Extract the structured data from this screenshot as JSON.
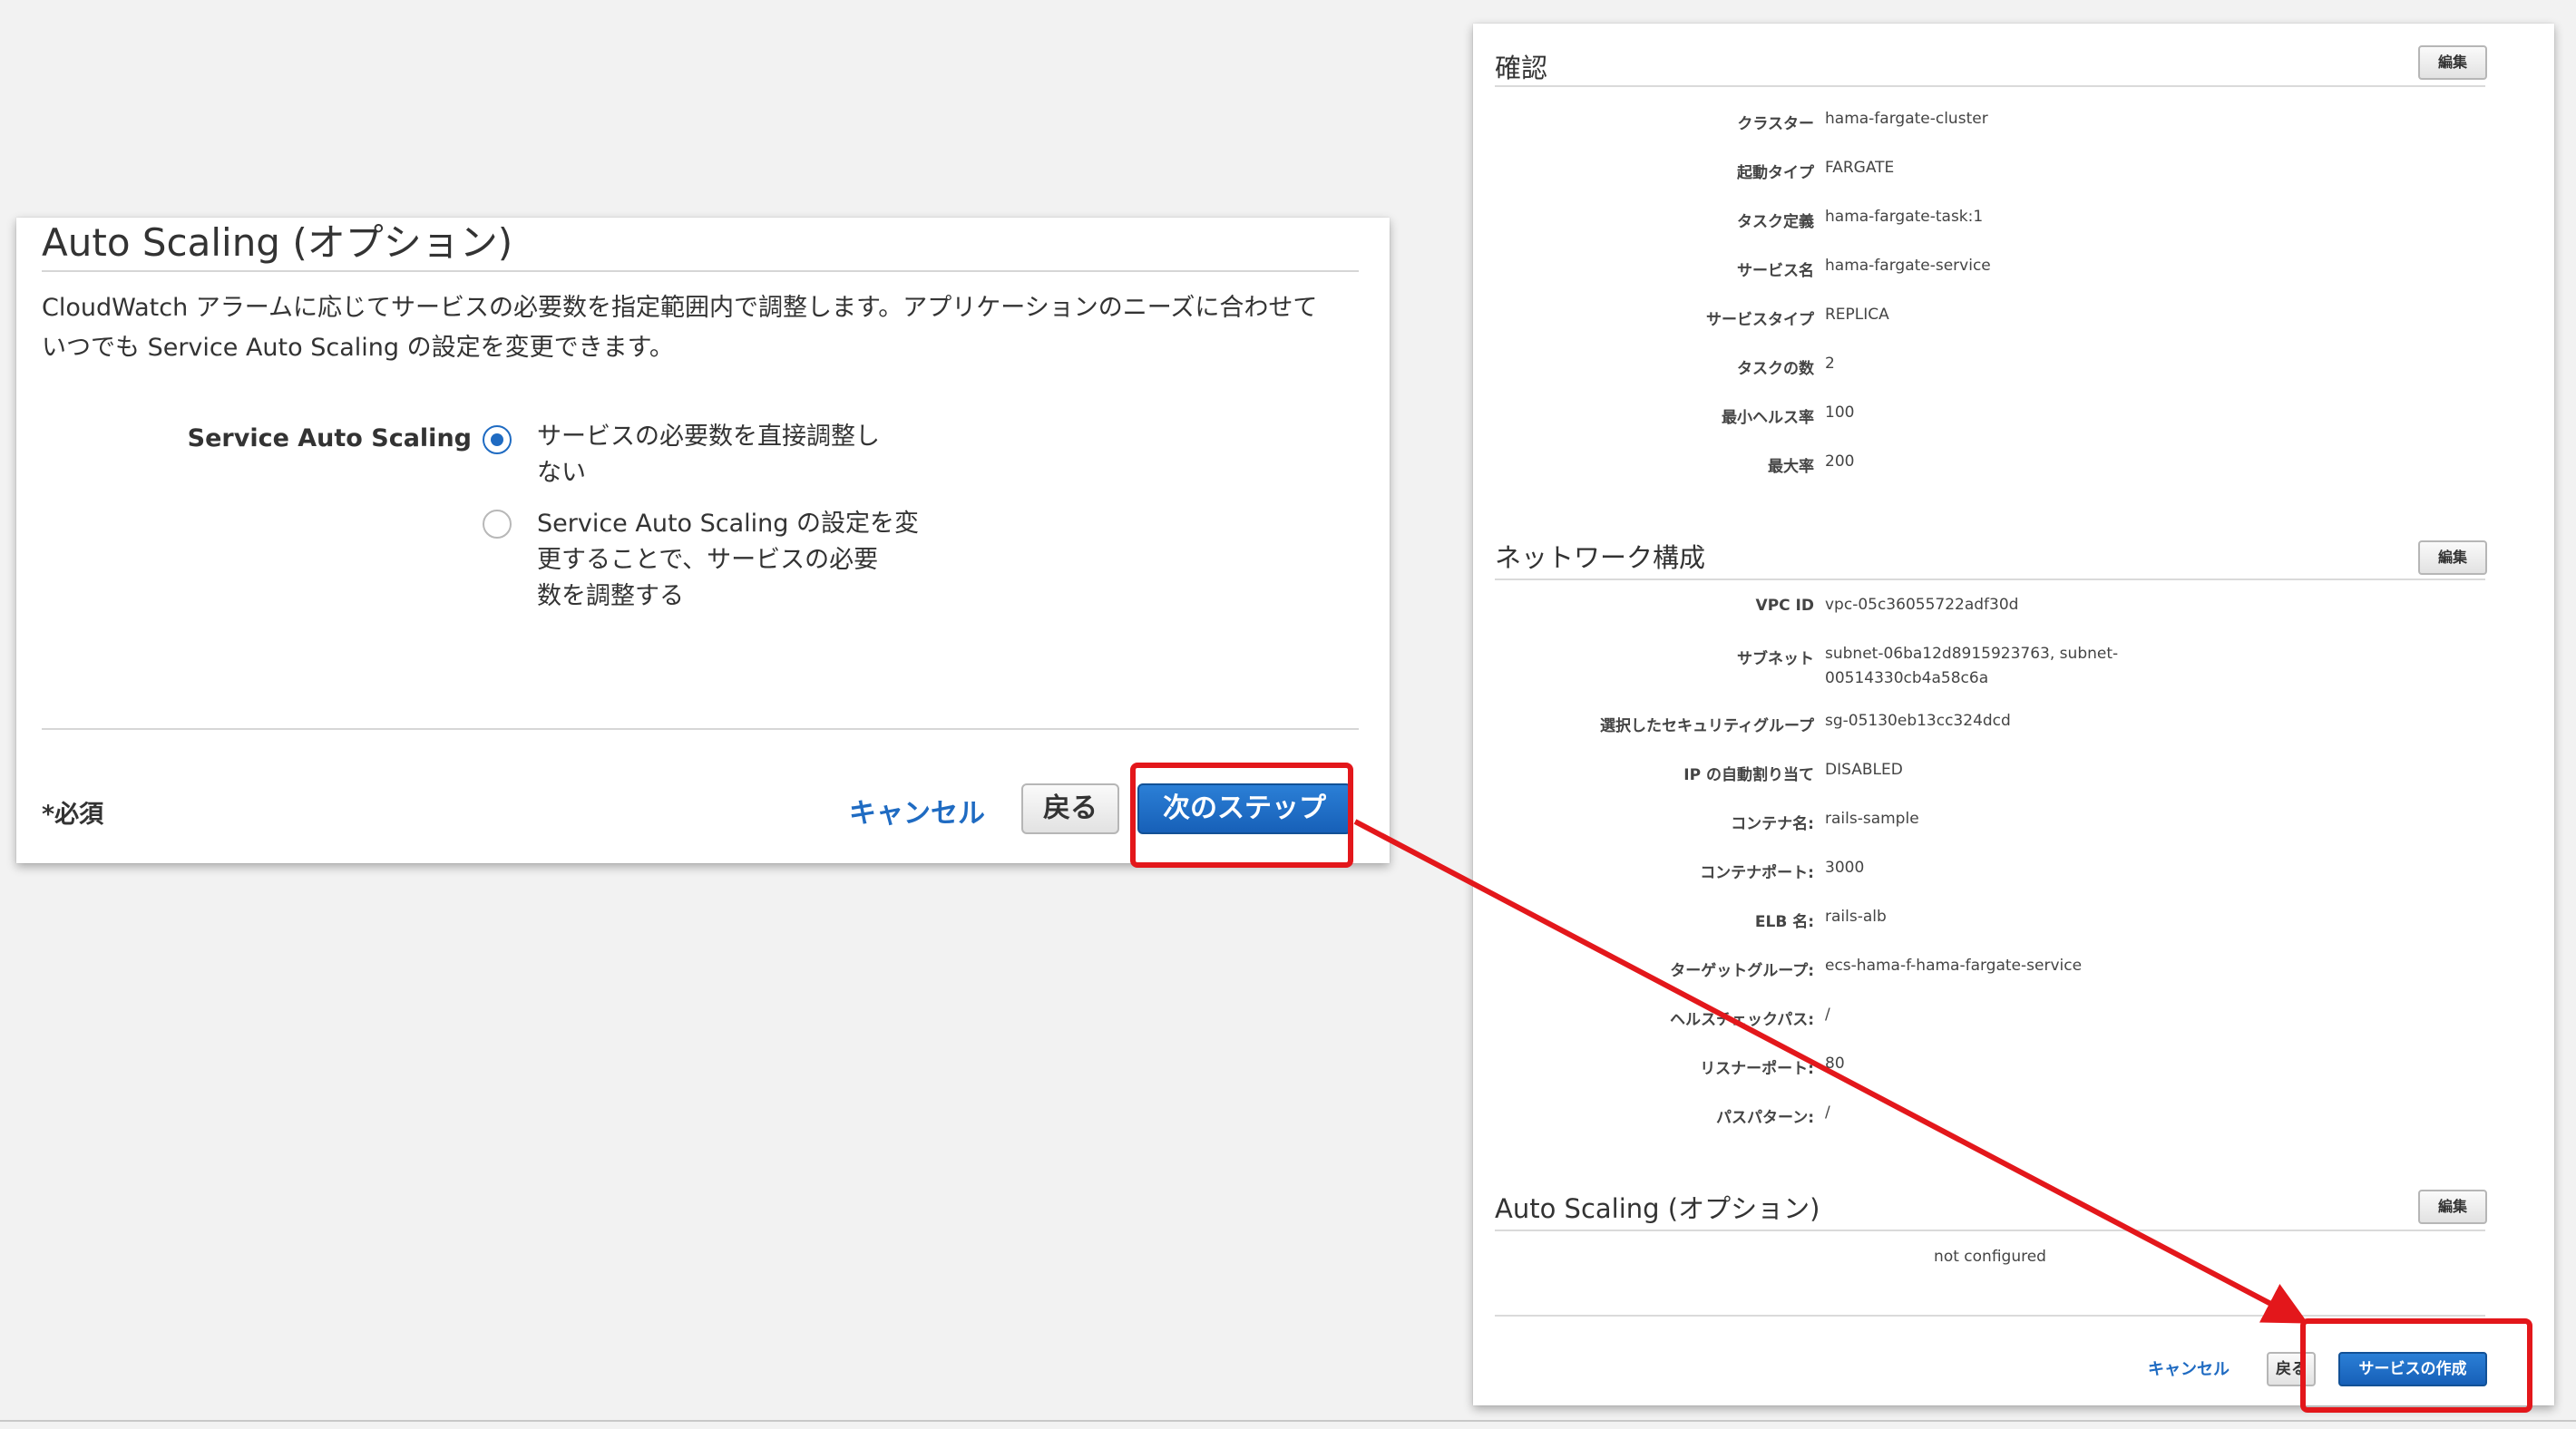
{
  "left": {
    "title": "Auto Scaling (オプション)",
    "desc_line1": "CloudWatch アラームに応じてサービスの必要数を指定範囲内で調整します。アプリケーションのニーズに合わせて",
    "desc_line2": "いつでも Service Auto Scaling の設定を変更できます。",
    "field_label": "Service Auto Scaling",
    "options": [
      {
        "line1": "サービスの必要数を直接調整し",
        "line2": "ない",
        "line3": "",
        "selected": true
      },
      {
        "line1": "Service Auto Scaling の設定を変",
        "line2": "更することで、サービスの必要",
        "line3": "数を調整する",
        "selected": false
      }
    ],
    "required_note": "*必須",
    "cancel_label": "キャンセル",
    "back_label": "戻る",
    "next_label": "次のステップ"
  },
  "right": {
    "edit_label": "編集",
    "confirm": {
      "title": "確認",
      "rows": [
        {
          "label": "クラスター",
          "value": "hama-fargate-cluster"
        },
        {
          "label": "起動タイプ",
          "value": "FARGATE"
        },
        {
          "label": "タスク定義",
          "value": "hama-fargate-task:1"
        },
        {
          "label": "サービス名",
          "value": "hama-fargate-service"
        },
        {
          "label": "サービスタイプ",
          "value": "REPLICA"
        },
        {
          "label": "タスクの数",
          "value": "2"
        },
        {
          "label": "最小ヘルス率",
          "value": "100"
        },
        {
          "label": "最大率",
          "value": "200"
        }
      ]
    },
    "network": {
      "title": "ネットワーク構成",
      "rows": [
        {
          "label": "VPC ID",
          "value": "vpc-05c36055722adf30d"
        },
        {
          "label": "サブネット",
          "value": "subnet-06ba12d8915923763, subnet-",
          "value2": "00514330cb4a58c6a"
        },
        {
          "label": "選択したセキュリティグループ",
          "value": "sg-05130eb13cc324dcd"
        },
        {
          "label": "IP の自動割り当て",
          "value": "DISABLED"
        },
        {
          "label": "コンテナ名:",
          "value": "rails-sample"
        },
        {
          "label": "コンテナポート:",
          "value": "3000"
        },
        {
          "label": "ELB 名:",
          "value": "rails-alb"
        },
        {
          "label": "ターゲットグループ:",
          "value": "ecs-hama-f-hama-fargate-service"
        },
        {
          "label": "ヘルスチェックパス:",
          "value": "/"
        },
        {
          "label": "リスナーポート:",
          "value": "80"
        },
        {
          "label": "パスパターン:",
          "value": "/"
        }
      ]
    },
    "autoscaling": {
      "title": "Auto Scaling (オプション)",
      "status": "not configured"
    },
    "cancel_label": "キャンセル",
    "back_label": "戻る",
    "create_label": "サービスの作成"
  },
  "colors": {
    "accent_blue": "#1f6bc2",
    "annotation_red": "#e3171b"
  }
}
